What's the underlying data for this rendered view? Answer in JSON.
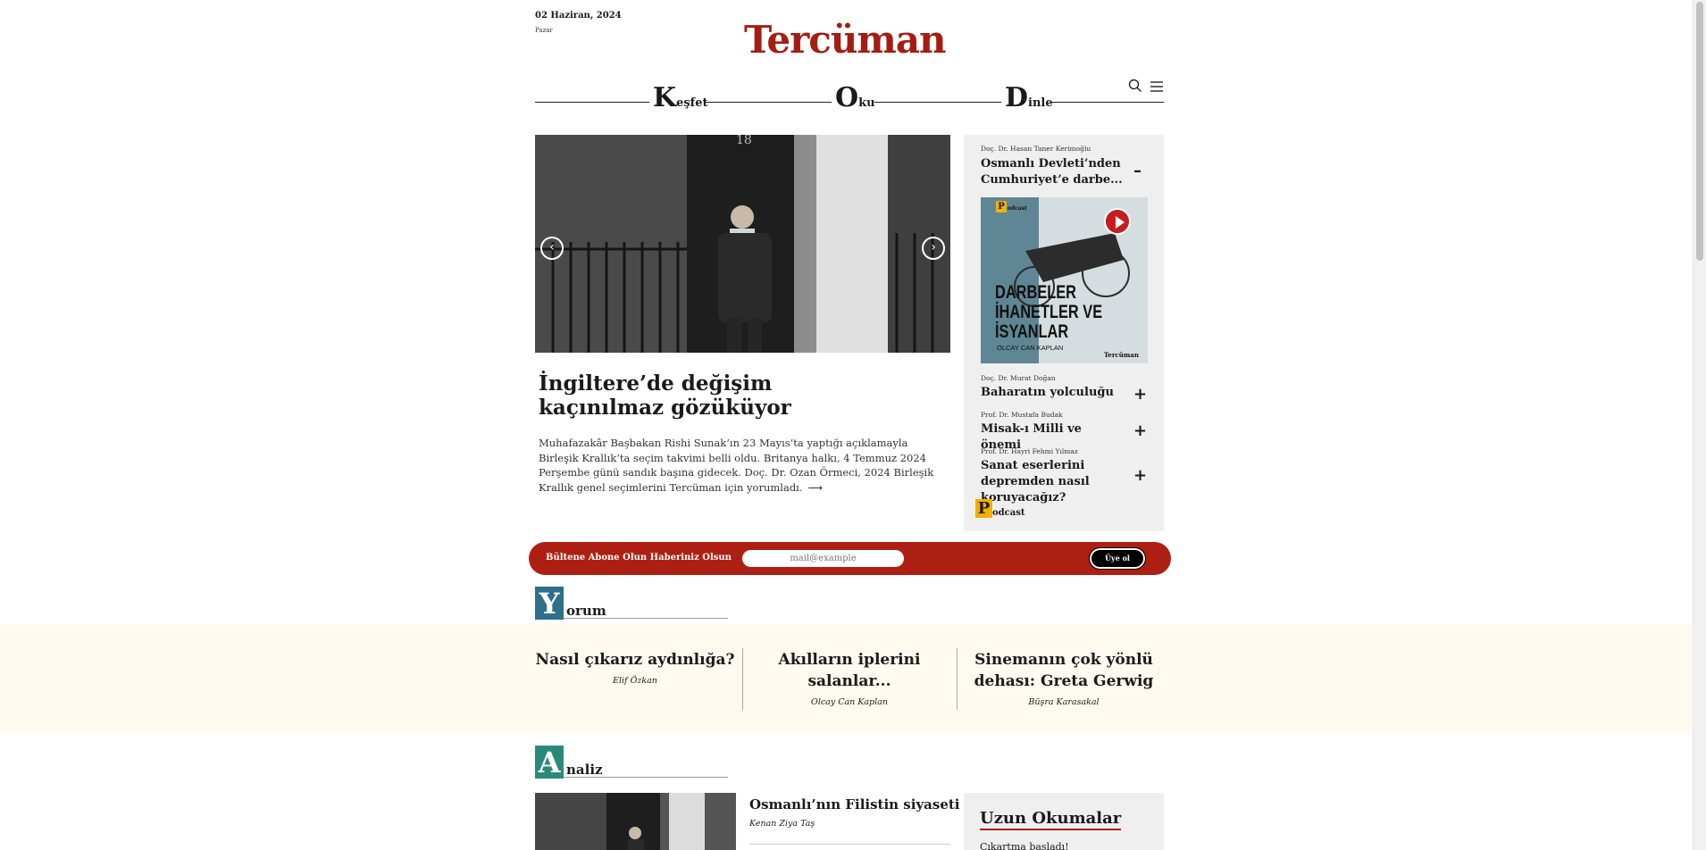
{
  "header": {
    "date": "02 Haziran, 2024",
    "day": "Pazar",
    "logo": "Tercüman"
  },
  "nav": {
    "items": [
      {
        "cap": "K",
        "rest": "eşfet"
      },
      {
        "cap": "O",
        "rest": "ku"
      },
      {
        "cap": "D",
        "rest": "inle"
      }
    ],
    "search_icon": "search-icon",
    "menu_icon": "menu-icon"
  },
  "hero": {
    "prev_label": "‹",
    "next_label": "›",
    "title": "İngiltere’de değişim kaçınılmaz gözüküyor",
    "summary": "Muhafazakâr Başbakan Rishi Sunak’ın 23 Mayıs’ta yaptığı açıklamayla Birleşik Krallık’ta seçim takvimi belli oldu. Britanya halkı, 4 Temmuz 2024 Perşembe günü sandık başına gidecek. Doç. Dr. Ozan Örmeci, 2024 Birleşik Krallık genel seçimlerini Tercüman için yorumladı.",
    "read_more": "⟶"
  },
  "podcast": {
    "featured": {
      "author": "Doç. Dr. Hasan Taner Kerimoğlu",
      "title": "Osmanlı Devleti’nden Cumhuriyet’e darbe...",
      "toggle": "–",
      "cover": {
        "badge": "P",
        "badge_text": "odcast",
        "title_lines": [
          "DARBELER",
          "İHANETLER VE",
          "İSYANLAR"
        ],
        "subtitle": "OLCAY CAN KAPLAN",
        "brand": "Tercüman"
      }
    },
    "items": [
      {
        "author": "Doç. Dr. Murat Doğan",
        "title": "Baharatın yolculuğu",
        "toggle": "+"
      },
      {
        "author": "Prof. Dr. Mustafa Budak",
        "title": "Misak-ı Milli ve önemi",
        "toggle": "+"
      },
      {
        "author": "Prof. Dr. Hayri Fehmi Yılmaz",
        "title": "Sanat eserlerini depremden nasıl koruyacağız?",
        "toggle": "+"
      }
    ],
    "logo_cap": "P",
    "logo_rest": "odcast"
  },
  "newsletter": {
    "label": "Bültene Abone Olun Haberiniz Olsun",
    "placeholder": "mail@example",
    "button": "Üye ol",
    "color": "#ad1f12"
  },
  "yorum": {
    "cap": "Y",
    "rest": "orum",
    "color": "#2e6f8a",
    "articles": [
      {
        "title": "Nasıl çıkarız aydınlığa?",
        "author": "Elif Özkan"
      },
      {
        "title": "Akılların iplerini salanlar...",
        "author": "Olcay Can Kaplan"
      },
      {
        "title": "Sinemanın çok yönlü dehası: Greta Gerwig",
        "author": "Büşra Karasakal"
      }
    ]
  },
  "analiz": {
    "cap": "A",
    "rest": "naliz",
    "color": "#2a8a78",
    "article": {
      "title": "Osmanlı’nın Filistin siyaseti",
      "author": "Kenan Ziya Taş"
    }
  },
  "uzun": {
    "heading": "Uzun Okumalar",
    "first_item": "Çıkartma başladı!"
  }
}
